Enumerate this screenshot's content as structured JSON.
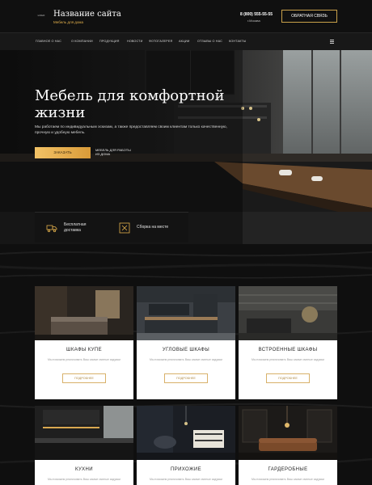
{
  "header": {
    "logo_text": "LOGO",
    "site_title": "Название сайта",
    "site_subtitle": "Мебель для дома",
    "phone": "8 (800) 555-55-55",
    "city": "г.Москва",
    "callback_label": "ОБРАТНАЯ СВЯЗЬ"
  },
  "nav": {
    "items": [
      "ГЛАВНОЕ О НАС",
      "О КОМПАНИИ",
      "ПРОДУКЦИЯ",
      "НОВОСТИ",
      "ФОТОГАЛЕРЕЯ",
      "АКЦИИ",
      "ОТЗЫВЫ О НАС",
      "КОНТАКТЫ"
    ],
    "menu_icon": "hamburger-icon"
  },
  "hero": {
    "title": "Мебель для комфортной жизни",
    "text": "Мы работаем по индивидуальным эскизам, а также предоставляем своим клиентам только качественную, прочную и удобную мебель.",
    "catalog_label": "ЗАКАЗАТЬ",
    "note": "МЕБЕЛЬ ДЛЯ РАБОТЫ ИЗ ДОМА"
  },
  "features": [
    {
      "label": "Бесплатная доставка",
      "icon": "truck-icon"
    },
    {
      "label": "Сборка на месте",
      "icon": "tools-icon"
    }
  ],
  "cards": [
    {
      "title": "ШКАФЫ КУПЕ",
      "desc": "Мы поможем реализовать Ваш самые смелые задумки",
      "button": "ПОДРОБНЕЕ"
    },
    {
      "title": "УГЛОВЫЕ ШКАФЫ",
      "desc": "Мы поможем реализовать Ваш самые смелые задумки",
      "button": "ПОДРОБНЕЕ"
    },
    {
      "title": "ВСТРОЕННЫЕ ШКАФЫ",
      "desc": "Мы поможем реализовать Ваш самые смелые задумки",
      "button": "ПОДРОБНЕЕ"
    },
    {
      "title": "КУХНИ",
      "desc": "Мы поможем реализовать Ваш самые смелые задумки",
      "button": "ПОДРОБНЕЕ"
    },
    {
      "title": "ПРИХОЖИЕ",
      "desc": "Мы поможем реализовать Ваш самые смелые задумки",
      "button": "ПОДРОБНЕЕ"
    },
    {
      "title": "ГАРДЕРОБНЫЕ",
      "desc": "Мы поможем реализовать Ваш самые смелые задумки",
      "button": "ПОДРОБНЕЕ"
    }
  ],
  "colors": {
    "accent": "#e3b04b",
    "background": "#111111",
    "card_bg": "#ffffff"
  }
}
